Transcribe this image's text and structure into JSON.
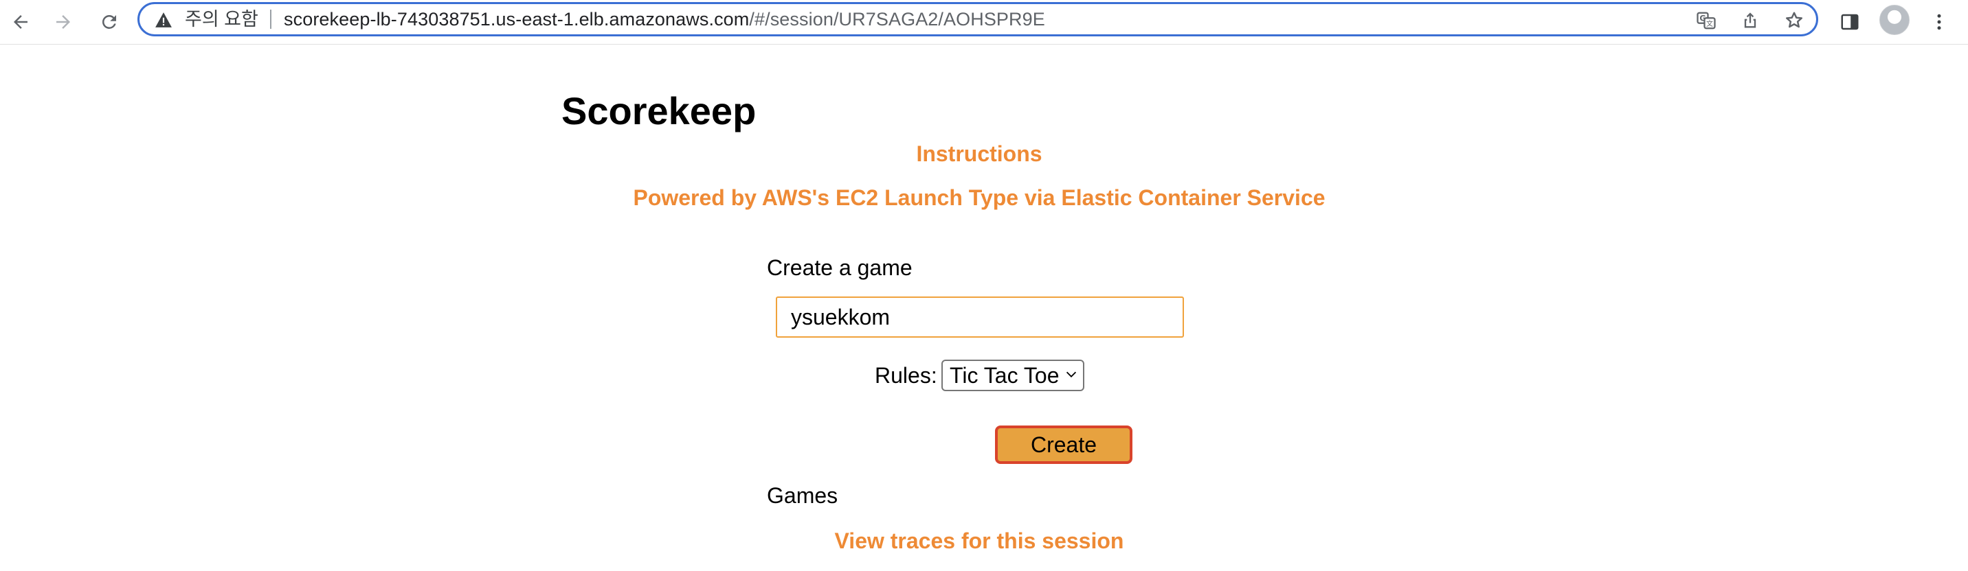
{
  "browser": {
    "security_label": "주의 요함",
    "url_host": "scorekeep-lb-743038751.us-east-1.elb.amazonaws.com",
    "url_path": "/#/session/UR7SAGA2/AOHSPR9E",
    "icons": [
      "back-icon",
      "forward-icon",
      "reload-icon",
      "warning-icon",
      "translate-icon",
      "share-icon",
      "bookmark-star-icon",
      "side-panel-icon",
      "avatar",
      "more-menu-icon"
    ]
  },
  "page": {
    "title": "Scorekeep",
    "instructions_link": "Instructions",
    "powered_by": "Powered by AWS's EC2 Launch Type via Elastic Container Service",
    "create_label": "Create a game",
    "game_name_value": "ysuekkom",
    "rules_label": "Rules:",
    "rules_selected": "Tic Tac Toe",
    "create_button": "Create",
    "games_label": "Games",
    "traces_link": "View traces for this session"
  },
  "colors": {
    "accent_orange": "#ee8a35",
    "button_fill": "#e7a23f",
    "button_border": "#d9432b",
    "input_border": "#f0a23c",
    "omnibox_border": "#3b6fd4"
  }
}
